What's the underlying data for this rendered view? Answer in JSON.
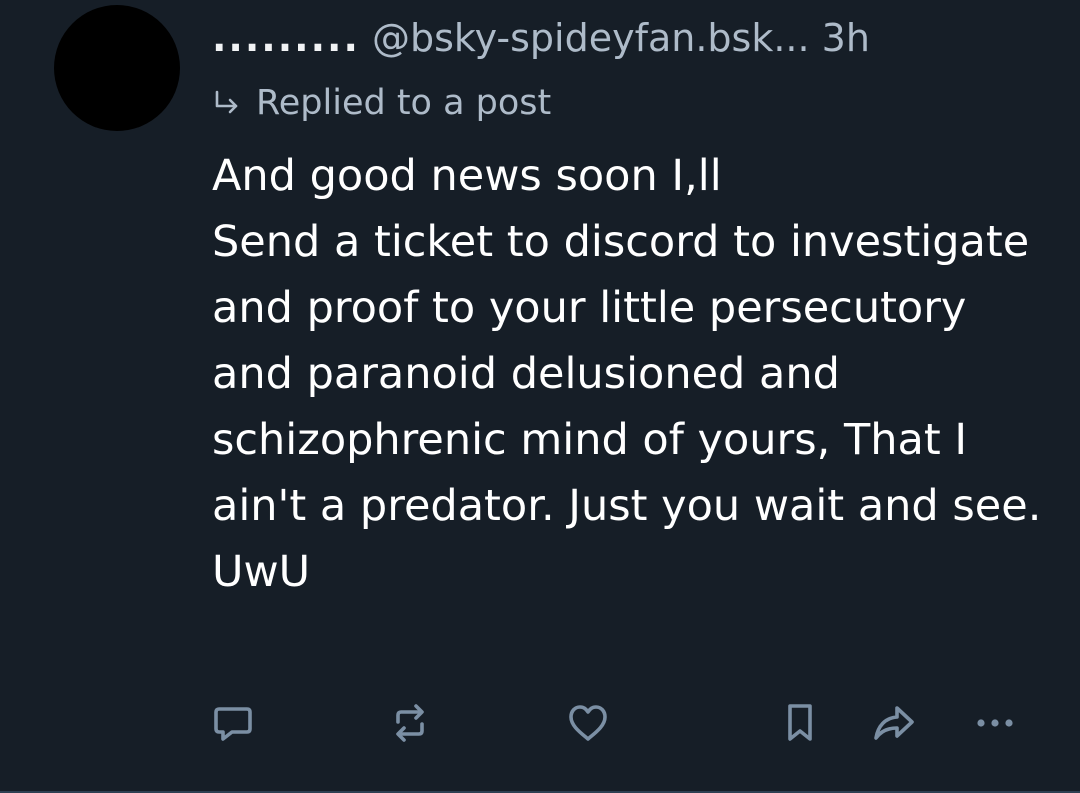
{
  "post": {
    "display_name": ".........",
    "handle": "@bsky-spideyfan.bsk...",
    "timestamp": "3h",
    "reply_label": "Replied to a post",
    "reply_icon": "reply-arrow-icon",
    "text": "And good news soon I,ll\nSend a ticket to discord to investigate and proof to your little persecutory and paranoid delusioned and schizophrenic mind of yours, That I ain't a predator. Just you wait and see. UwU"
  },
  "actions": {
    "icons": [
      "comment-icon",
      "repost-icon",
      "like-icon",
      "bookmark-icon",
      "share-icon",
      "more-icon"
    ],
    "icon_color": "#7b8fa4"
  },
  "colors": {
    "background": "#161e27",
    "text": "#ffffff",
    "muted": "#aebbc9"
  }
}
